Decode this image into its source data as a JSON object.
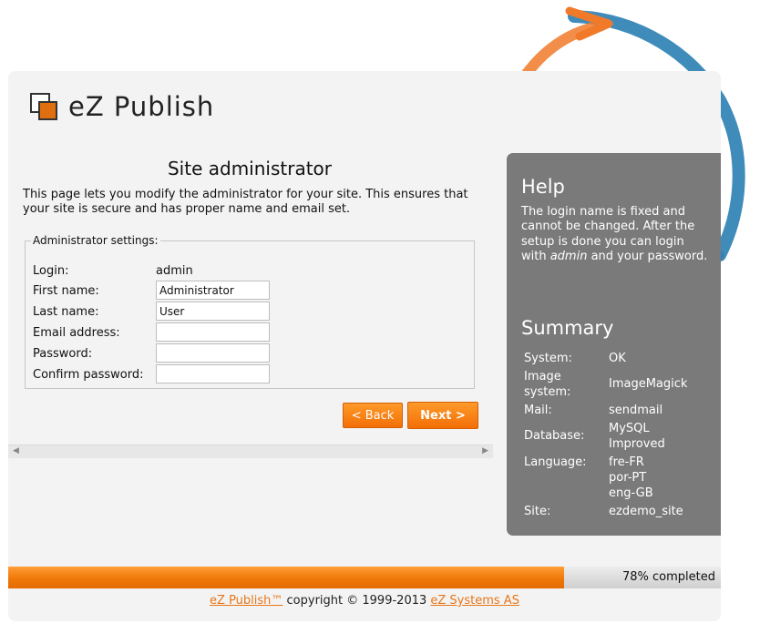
{
  "brand": {
    "name": "eZ Publish"
  },
  "page": {
    "title": "Site administrator",
    "intro": "This page lets you modify the administrator for your site. This ensures that your site is secure and has proper name and email set."
  },
  "form": {
    "legend": "Administrator settings:",
    "login_label": "Login:",
    "login_value": "admin",
    "first_name_label": "First name:",
    "first_name_value": "Administrator",
    "last_name_label": "Last name:",
    "last_name_value": "User",
    "email_label": "Email address:",
    "email_value": "",
    "password_label": "Password:",
    "password_value": "",
    "confirm_password_label": "Confirm password:",
    "confirm_password_value": ""
  },
  "buttons": {
    "back": "< Back",
    "next": "Next >"
  },
  "help": {
    "title": "Help",
    "text_before": "The login name is fixed and cannot be changed. After the setup is done you can login with ",
    "text_em": "admin",
    "text_after": " and your password."
  },
  "summary": {
    "title": "Summary",
    "system_label": "System:",
    "system_value": "OK",
    "image_system_label": "Image system:",
    "image_system_value": "ImageMagick",
    "mail_label": "Mail:",
    "mail_value": "sendmail",
    "database_label": "Database:",
    "database_value": "MySQL Improved",
    "language_label": "Language:",
    "language_value_1": "fre-FR",
    "language_value_2": "por-PT",
    "language_value_3": "eng-GB",
    "site_label": "Site:",
    "site_value": "ezdemo_site"
  },
  "progress": {
    "percent": 78,
    "label": "78% completed"
  },
  "footer": {
    "product_link": "eZ Publish™",
    "copyright": " copyright © 1999-2013 ",
    "company_link": "eZ Systems AS"
  },
  "colors": {
    "accent": "#f07808",
    "sidebar": "#7a7a7a",
    "swirl_orange": "#f07a2a",
    "swirl_blue": "#2a7fb4"
  }
}
